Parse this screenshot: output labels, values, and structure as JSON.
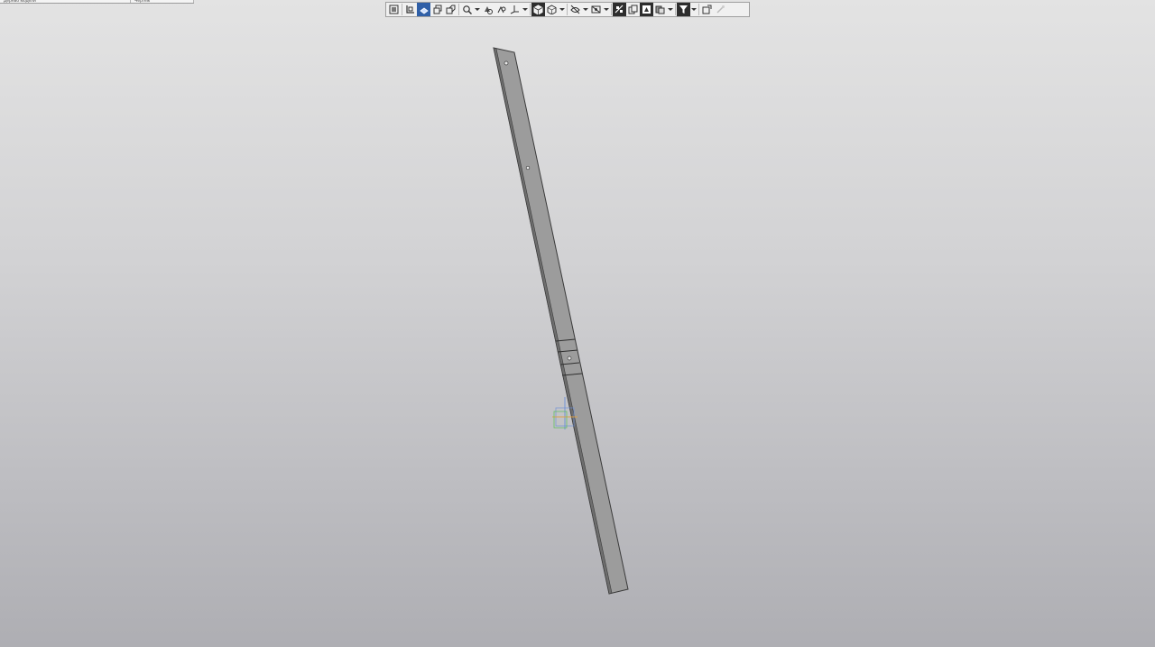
{
  "tree_strip": {
    "col1": "Дерево модели",
    "col2": "Чертеж"
  },
  "toolbar": {
    "buttons": [
      {
        "icon": "fit-all-icon"
      },
      {
        "icon": "orient-front-icon"
      },
      {
        "icon": "orient-iso-icon",
        "state": "active"
      },
      {
        "icon": "scene-view-icon"
      },
      {
        "icon": "scene-view-2-icon"
      },
      {
        "icon": "zoom-icon",
        "dropdown": true
      },
      {
        "icon": "rotate-icon"
      },
      {
        "icon": "pan-icon"
      },
      {
        "icon": "axes-orientation-icon",
        "dropdown": true
      },
      {
        "icon": "shaded-cube-icon",
        "state": "active"
      },
      {
        "icon": "wireframe-cube-icon",
        "dropdown": true
      },
      {
        "icon": "hide-eye-icon",
        "dropdown": true
      },
      {
        "icon": "hide-objects-icon",
        "dropdown": true
      },
      {
        "icon": "section-icon",
        "state": "active"
      },
      {
        "icon": "copy-view-icon"
      },
      {
        "icon": "perspective-icon",
        "state": "active"
      },
      {
        "icon": "layers-icon",
        "dropdown": true
      },
      {
        "icon": "filter-icon",
        "state": "active",
        "dropdown": true
      },
      {
        "icon": "measure-icon"
      },
      {
        "icon": "disabled-tool-icon"
      }
    ]
  },
  "colors": {
    "viewport_top": "#e3e3e3",
    "viewport_bottom": "#aeaeb3",
    "part_face": "#9a9a9a",
    "part_edge": "#3a3a3a",
    "active_button": "#2d2d2d",
    "active_blue_button": "#2f5fa7",
    "origin_green": "#5bbf5b",
    "origin_blue": "#6a8fd8",
    "origin_orange": "#e0a040"
  }
}
